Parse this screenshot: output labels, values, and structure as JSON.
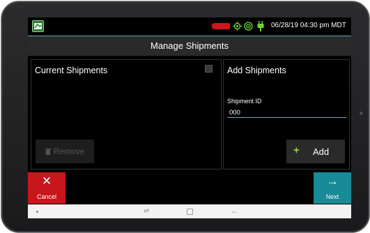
{
  "status": {
    "datetime": "06/28/19 04:30 pm MDT",
    "icons": [
      "app-logo-icon",
      "red-status-icon",
      "gps-icon",
      "signal-icon",
      "plug-icon"
    ]
  },
  "header": {
    "title": "Manage Shipments"
  },
  "current_shipments": {
    "title": "Current Shipments",
    "remove_label": "Remove"
  },
  "add_shipments": {
    "title": "Add Shipments",
    "field_label": "Shipment ID",
    "field_value": "000",
    "add_label": "Add"
  },
  "actions": {
    "cancel_label": "Cancel",
    "next_label": "Next"
  },
  "colors": {
    "cancel": "#c8161c",
    "next": "#198a98",
    "accent": "#5fa8c8",
    "add_plus": "#8ed83a"
  }
}
